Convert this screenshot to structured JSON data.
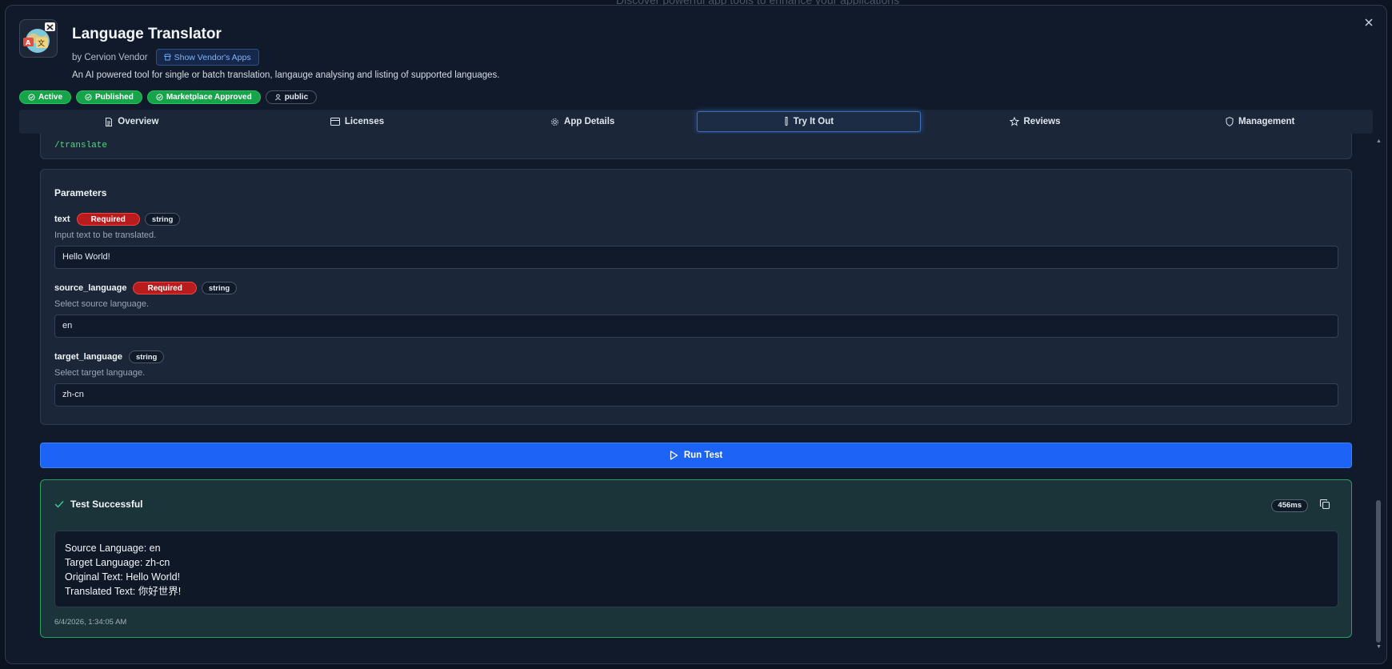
{
  "backdrop": {
    "hint_text": "Discover powerful app tools to enhance your applications"
  },
  "app": {
    "title": "Language Translator",
    "vendor": "by Cervion Vendor",
    "vendor_button": "Show Vendor's Apps",
    "description": "An AI powered tool for single or batch translation, langauge analysing and listing of supported languages.",
    "icon": "translate-globe-icon"
  },
  "badges": [
    {
      "label": "Active",
      "icon": "check-circle-icon",
      "style": "green"
    },
    {
      "label": "Published",
      "icon": "check-circle-icon",
      "style": "green"
    },
    {
      "label": "Marketplace Approved",
      "icon": "check-circle-icon",
      "style": "green"
    },
    {
      "label": "public",
      "icon": "user-icon",
      "style": "dark"
    }
  ],
  "tabs": [
    {
      "label": "Overview",
      "icon": "document-icon",
      "active": false
    },
    {
      "label": "Licenses",
      "icon": "credit-card-icon",
      "active": false
    },
    {
      "label": "App Details",
      "icon": "gear-icon",
      "active": false
    },
    {
      "label": "Try It Out",
      "icon": "test-tube-icon",
      "active": true
    },
    {
      "label": "Reviews",
      "icon": "star-icon",
      "active": false
    },
    {
      "label": "Management",
      "icon": "shield-icon",
      "active": false
    }
  ],
  "endpoint": {
    "path": "/translate"
  },
  "parameters": {
    "title": "Parameters",
    "required_label": "Required",
    "items": [
      {
        "name": "text",
        "required": true,
        "type": "string",
        "description": "Input text to be translated.",
        "value": "Hello World!"
      },
      {
        "name": "source_language",
        "required": true,
        "type": "string",
        "description": "Select source language.",
        "value": "en"
      },
      {
        "name": "target_language",
        "required": false,
        "type": "string",
        "description": "Select target language.",
        "value": "zh-cn"
      }
    ]
  },
  "run_button": {
    "label": "Run Test"
  },
  "result": {
    "title": "Test Successful",
    "duration": "456ms",
    "lines": [
      "Source Language: en",
      "Target Language: zh-cn",
      "Original Text: Hello World!",
      "Translated Text: 你好世界!"
    ],
    "timestamp": "6/4/2026, 1:34:05 AM"
  },
  "colors": {
    "accent": "#1d63f5",
    "success": "#22a35a",
    "required": "#b91c1c",
    "badge_green": "#16a34a"
  }
}
